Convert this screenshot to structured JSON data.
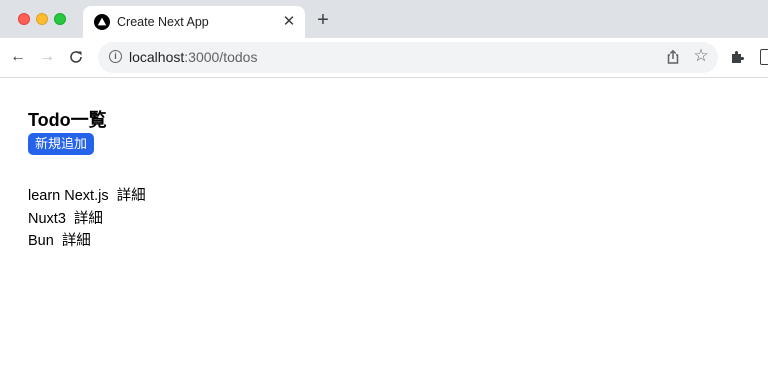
{
  "browser": {
    "tab": {
      "title": "Create Next App"
    },
    "new_tab_symbol": "+",
    "address_bar": {
      "host": "localhost",
      "path": ":3000/todos"
    }
  },
  "page": {
    "title": "Todo一覧",
    "add_button_label": "新規追加",
    "todos": [
      {
        "title": "learn Next.js",
        "detail_label": "詳細"
      },
      {
        "title": "Nuxt3",
        "detail_label": "詳細"
      },
      {
        "title": "Bun",
        "detail_label": "詳細"
      }
    ],
    "colors": {
      "button_bg": "#2563eb",
      "button_text": "#ffffff"
    }
  }
}
